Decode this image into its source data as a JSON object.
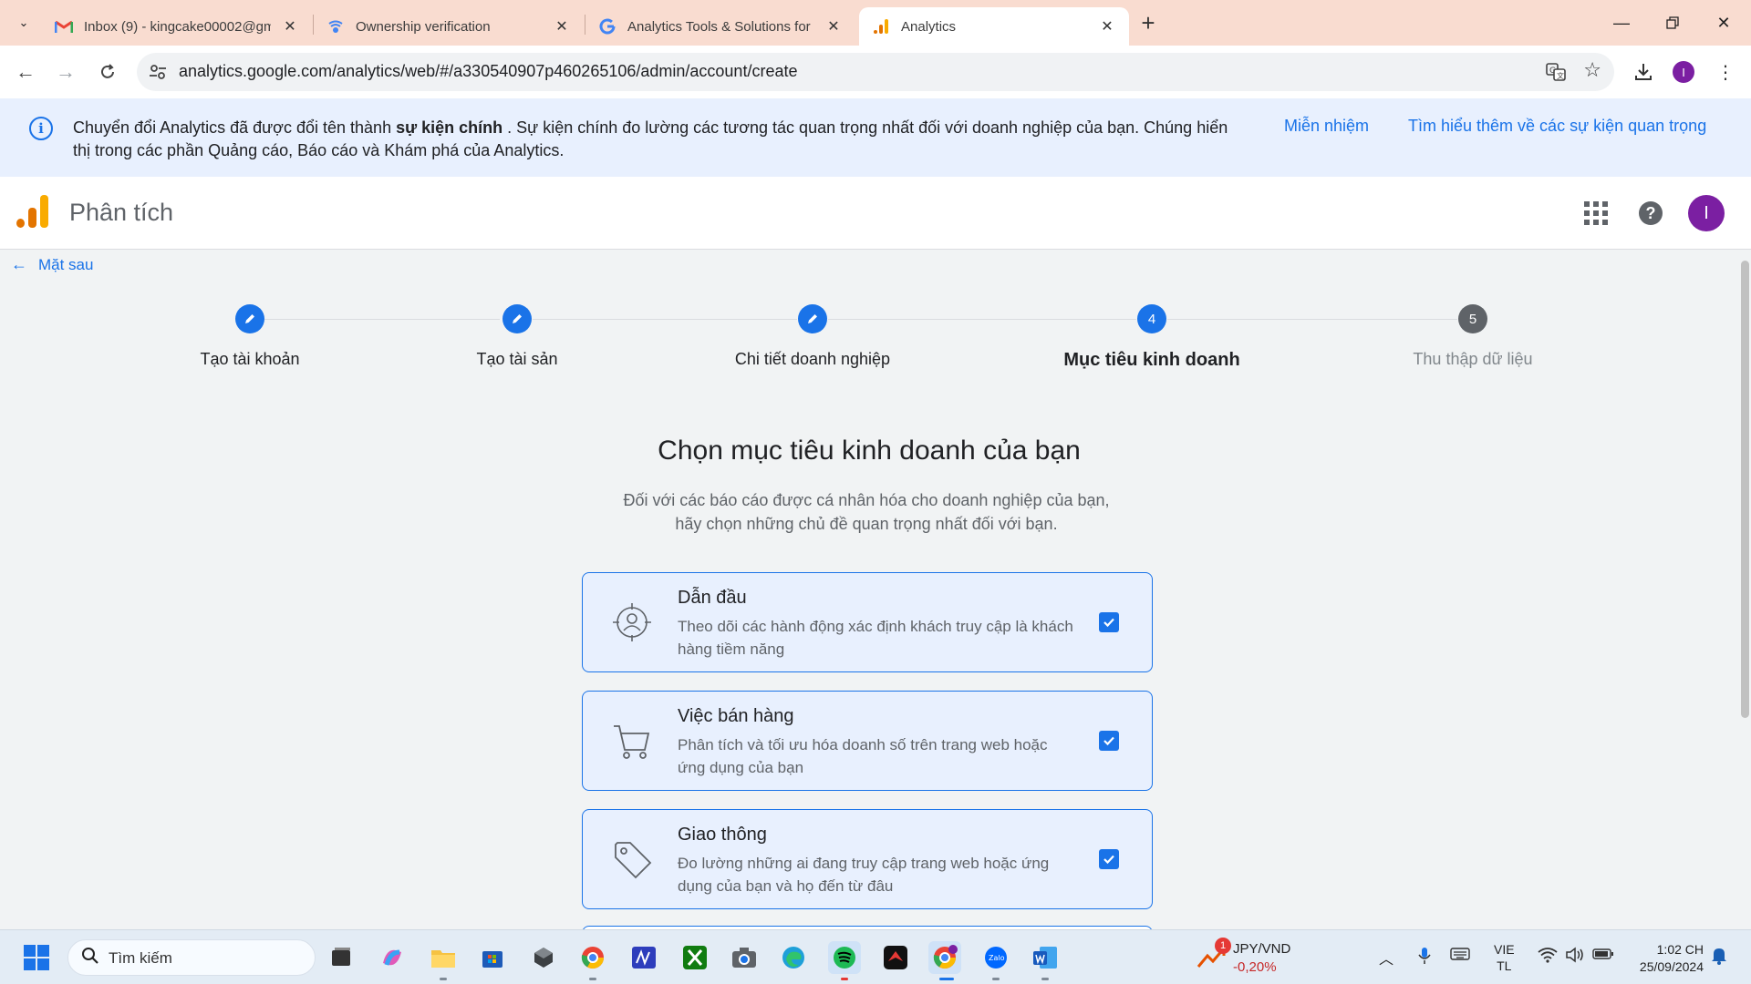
{
  "browser": {
    "tabs": [
      {
        "title": "Inbox (9) - kingcake00002@gm",
        "icon": "gmail-icon"
      },
      {
        "title": "Ownership verification",
        "icon": "verification-icon"
      },
      {
        "title": "Analytics Tools & Solutions for",
        "icon": "google-icon"
      },
      {
        "title": "Analytics",
        "icon": "analytics-icon",
        "active": true
      }
    ],
    "new_tab": "+",
    "url": "analytics.google.com/analytics/web/#/a330540907p460265106/admin/account/create",
    "profile_initial": "I"
  },
  "banner": {
    "message_pre": "Chuyển đổi Analytics đã được đổi tên thành ",
    "message_bold": "sự kiện chính",
    "message_post": " . Sự kiện chính đo lường các tương tác quan trọng nhất đối với doanh nghiệp của bạn. Chúng hiển thị trong các phần Quảng cáo, Báo cáo và Khám phá của Analytics.",
    "dismiss": "Miễn nhiệm",
    "learn_more": "Tìm hiểu thêm về các sự kiện quan trọng"
  },
  "app": {
    "title": "Phân tích",
    "profile_initial": "I",
    "accent": "#1a73e8"
  },
  "back_label": "Mặt sau",
  "stepper": [
    {
      "label": "Tạo tài khoản",
      "state": "done"
    },
    {
      "label": "Tạo tài sản",
      "state": "done"
    },
    {
      "label": "Chi tiết doanh nghiệp",
      "state": "done"
    },
    {
      "label": "Mục tiêu kinh doanh",
      "state": "current",
      "number": "4"
    },
    {
      "label": "Thu thập dữ liệu",
      "state": "pending",
      "number": "5"
    }
  ],
  "page": {
    "heading": "Chọn mục tiêu kinh doanh của bạn",
    "subtitle_line1": "Đối với các báo cáo được cá nhân hóa cho doanh nghiệp của bạn,",
    "subtitle_line2": "hãy chọn những chủ đề quan trọng nhất đối với bạn."
  },
  "objectives": [
    {
      "title": "Dẫn đầu",
      "description": "Theo dõi các hành động xác định khách truy cập là khách hàng tiềm năng",
      "checked": true,
      "icon": "lead-target-icon"
    },
    {
      "title": "Việc bán hàng",
      "description": "Phân tích và tối ưu hóa doanh số trên trang web hoặc ứng dụng của bạn",
      "checked": true,
      "icon": "shopping-cart-icon"
    },
    {
      "title": "Giao thông",
      "description": "Đo lường những ai đang truy cập trang web hoặc ứng dụng của bạn và họ đến từ đâu",
      "checked": true,
      "icon": "tag-icon"
    }
  ],
  "taskbar": {
    "search_placeholder": "Tìm kiếm",
    "widget_badge": "1",
    "fx_pair": "JPY/VND",
    "fx_change": "-0,20%",
    "lang_line1": "VIE",
    "lang_line2": "TL",
    "time": "1:02 CH",
    "date": "25/09/2024"
  }
}
